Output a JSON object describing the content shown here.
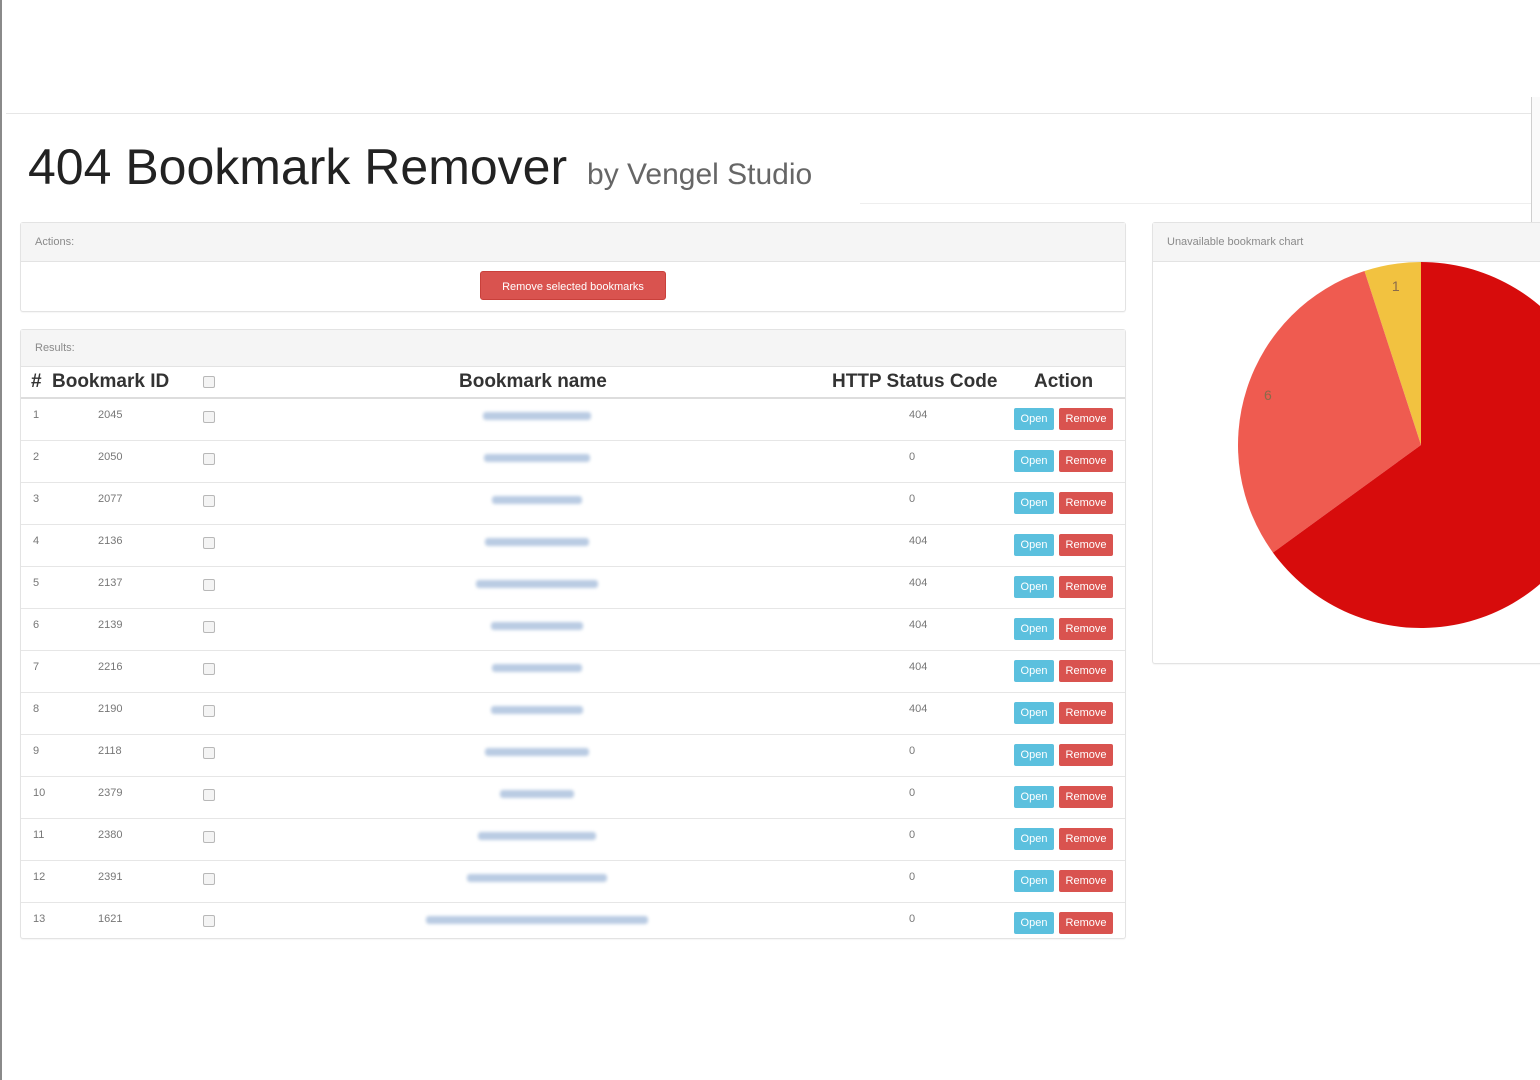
{
  "header": {
    "title": "404 Bookmark Remover",
    "subtitle": "by Vengel Studio"
  },
  "actions": {
    "heading": "Actions:",
    "remove_selected_label": "Remove selected bookmarks"
  },
  "results": {
    "heading": "Results:",
    "columns": [
      "#",
      "Bookmark ID",
      "Bookmark name",
      "HTTP Status Code",
      "Action"
    ],
    "open_label": "Open",
    "remove_label": "Remove",
    "rows": [
      {
        "num": "1",
        "id": "2045",
        "status": "404"
      },
      {
        "num": "2",
        "id": "2050",
        "status": "0"
      },
      {
        "num": "3",
        "id": "2077",
        "status": "0"
      },
      {
        "num": "4",
        "id": "2136",
        "status": "404"
      },
      {
        "num": "5",
        "id": "2137",
        "status": "404"
      },
      {
        "num": "6",
        "id": "2139",
        "status": "404"
      },
      {
        "num": "7",
        "id": "2216",
        "status": "404"
      },
      {
        "num": "8",
        "id": "2190",
        "status": "404"
      },
      {
        "num": "9",
        "id": "2118",
        "status": "0"
      },
      {
        "num": "10",
        "id": "2379",
        "status": "0"
      },
      {
        "num": "11",
        "id": "2380",
        "status": "0"
      },
      {
        "num": "12",
        "id": "2391",
        "status": "0"
      },
      {
        "num": "13",
        "id": "1621",
        "status": "0"
      }
    ]
  },
  "chart": {
    "heading": "Unavailable bookmark chart"
  },
  "chart_data": {
    "type": "pie",
    "slices": [
      {
        "label": "1",
        "value": 1,
        "color": "#f2c240"
      },
      {
        "label": "6",
        "value": 6,
        "color": "#ef5b50"
      },
      {
        "label": "",
        "value": 13,
        "color": "#d70c0c"
      }
    ]
  },
  "colors": {
    "danger": "#d9534f",
    "info": "#5bc0de"
  }
}
